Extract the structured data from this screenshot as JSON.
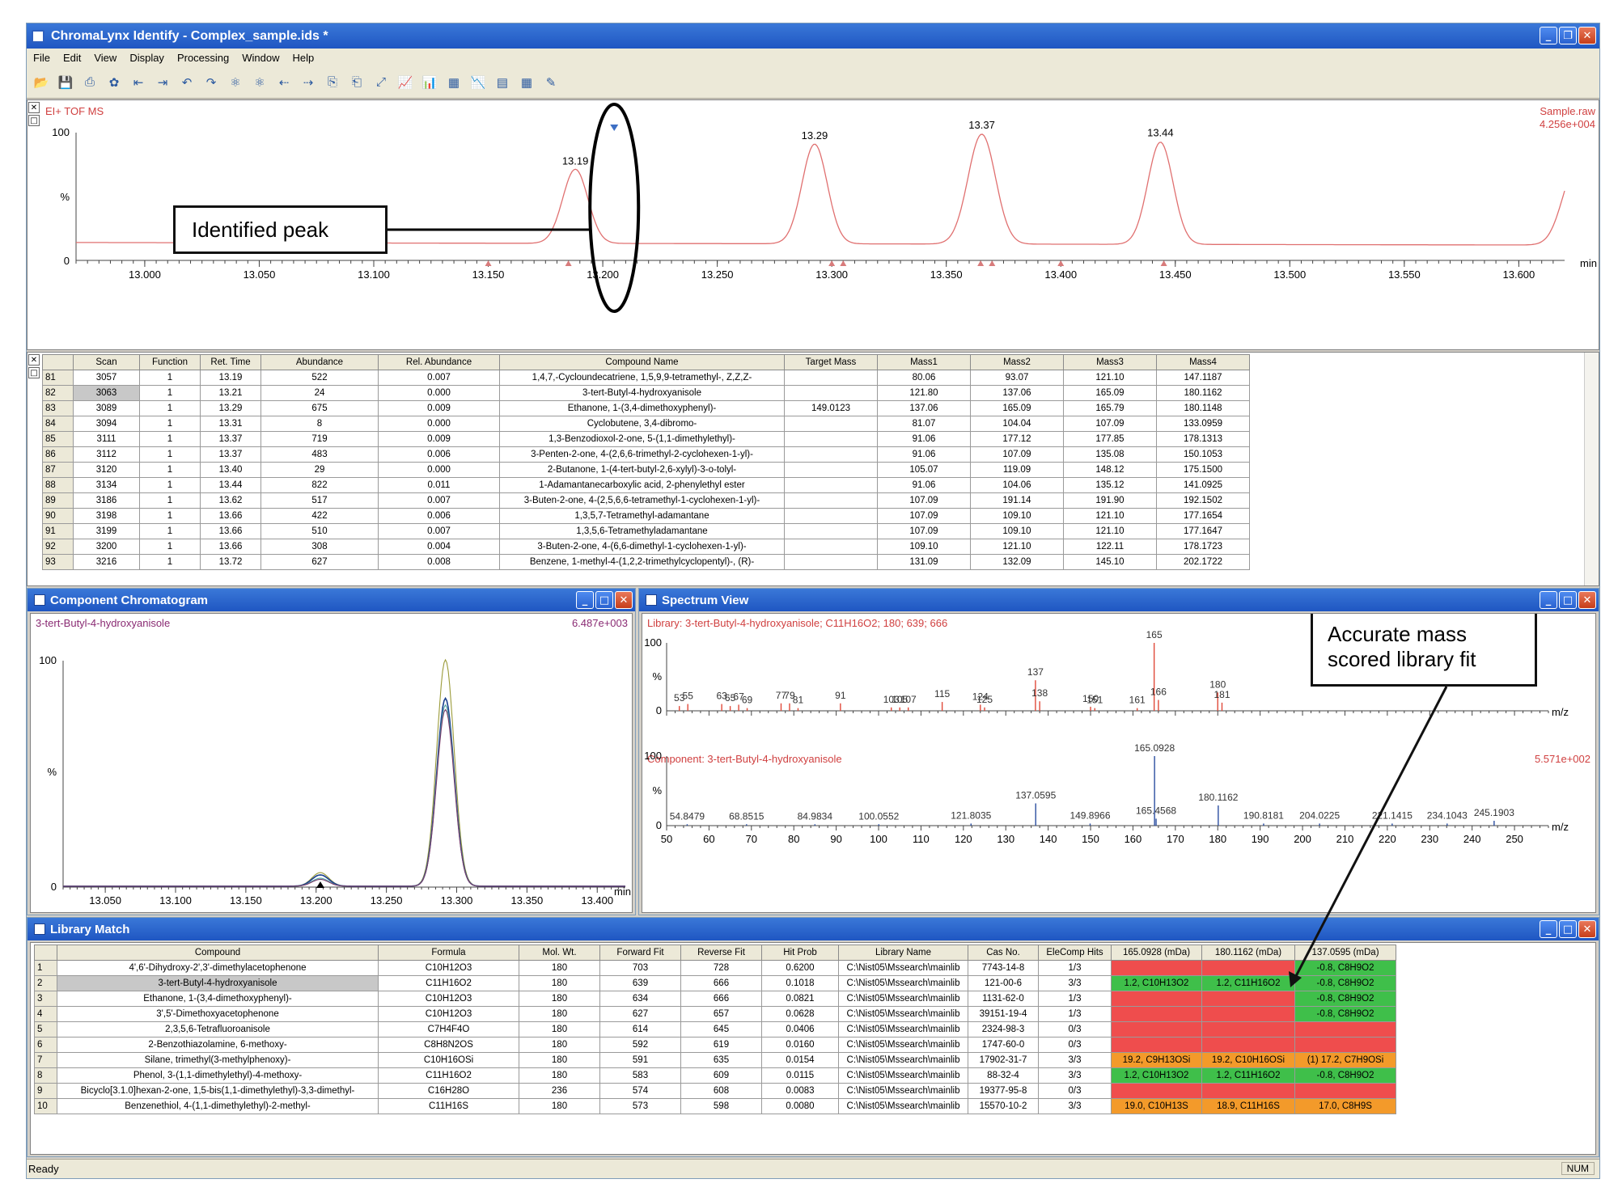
{
  "title": "ChromaLynx Identify - Complex_sample.ids *",
  "menu": [
    "File",
    "Edit",
    "View",
    "Display",
    "Processing",
    "Window",
    "Help"
  ],
  "status": "Ready",
  "num": "NUM",
  "tic": {
    "label": "EI+ TOF MS",
    "file": "Sample.raw",
    "intensity": "4.256e+004",
    "y100": "100",
    "ypct": "%",
    "y0": "0",
    "unit": "min",
    "ticks": [
      "13.000",
      "13.050",
      "13.100",
      "13.150",
      "13.200",
      "13.250",
      "13.300",
      "13.350",
      "13.400",
      "13.450",
      "13.500",
      "13.550",
      "13.600"
    ],
    "peaks": [
      "13.19",
      "13.29",
      "13.37",
      "13.44"
    ]
  },
  "callouts": {
    "identified": "Identified peak",
    "accurate1": "Accurate mass",
    "accurate2": "scored library fit"
  },
  "peak_table": {
    "headers": [
      "",
      "Scan",
      "Function",
      "Ret. Time",
      "Abundance",
      "Rel. Abundance",
      "Compound Name",
      "Target Mass",
      "Mass1",
      "Mass2",
      "Mass3",
      "Mass4"
    ],
    "rows": [
      [
        "81",
        "3057",
        "1",
        "13.19",
        "522",
        "0.007",
        "1,4,7,-Cycloundecatriene, 1,5,9,9-tetramethyl-, Z,Z,Z-",
        "",
        "80.06",
        "93.07",
        "121.10",
        "147.1187"
      ],
      [
        "82",
        "3063",
        "1",
        "13.21",
        "24",
        "0.000",
        "3-tert-Butyl-4-hydroxyanisole",
        "",
        "121.80",
        "137.06",
        "165.09",
        "180.1162"
      ],
      [
        "83",
        "3089",
        "1",
        "13.29",
        "675",
        "0.009",
        "Ethanone, 1-(3,4-dimethoxyphenyl)-",
        "149.0123",
        "137.06",
        "165.09",
        "165.79",
        "180.1148"
      ],
      [
        "84",
        "3094",
        "1",
        "13.31",
        "8",
        "0.000",
        "Cyclobutene, 3,4-dibromo-",
        "",
        "81.07",
        "104.04",
        "107.09",
        "133.0959"
      ],
      [
        "85",
        "3111",
        "1",
        "13.37",
        "719",
        "0.009",
        "1,3-Benzodioxol-2-one, 5-(1,1-dimethylethyl)-",
        "",
        "91.06",
        "177.12",
        "177.85",
        "178.1313"
      ],
      [
        "86",
        "3112",
        "1",
        "13.37",
        "483",
        "0.006",
        "3-Penten-2-one, 4-(2,6,6-trimethyl-2-cyclohexen-1-yl)-",
        "",
        "91.06",
        "107.09",
        "135.08",
        "150.1053"
      ],
      [
        "87",
        "3120",
        "1",
        "13.40",
        "29",
        "0.000",
        "2-Butanone, 1-(4-tert-butyl-2,6-xylyl)-3-o-tolyl-",
        "",
        "105.07",
        "119.09",
        "148.12",
        "175.1500"
      ],
      [
        "88",
        "3134",
        "1",
        "13.44",
        "822",
        "0.011",
        "1-Adamantanecarboxylic acid, 2-phenylethyl ester",
        "",
        "91.06",
        "104.06",
        "135.12",
        "141.0925"
      ],
      [
        "89",
        "3186",
        "1",
        "13.62",
        "517",
        "0.007",
        "3-Buten-2-one, 4-(2,5,6,6-tetramethyl-1-cyclohexen-1-yl)-",
        "",
        "107.09",
        "191.14",
        "191.90",
        "192.1502"
      ],
      [
        "90",
        "3198",
        "1",
        "13.66",
        "422",
        "0.006",
        "1,3,5,7-Tetramethyl-adamantane",
        "",
        "107.09",
        "109.10",
        "121.10",
        "177.1654"
      ],
      [
        "91",
        "3199",
        "1",
        "13.66",
        "510",
        "0.007",
        "1,3,5,6-Tetramethyladamantane",
        "",
        "107.09",
        "109.10",
        "121.10",
        "177.1647"
      ],
      [
        "92",
        "3200",
        "1",
        "13.66",
        "308",
        "0.004",
        "3-Buten-2-one, 4-(6,6-dimethyl-1-cyclohexen-1-yl)-",
        "",
        "109.10",
        "121.10",
        "122.11",
        "178.1723"
      ],
      [
        "93",
        "3216",
        "1",
        "13.72",
        "627",
        "0.008",
        "Benzene, 1-methyl-4-(1,2,2-trimethylcyclopentyl)-, (R)-",
        "",
        "131.09",
        "132.09",
        "145.10",
        "202.1722"
      ]
    ]
  },
  "component": {
    "title": "Component Chromatogram",
    "compound": "3-tert-Butyl-4-hydroxyanisole",
    "intensity": "6.487e+003",
    "y100": "100",
    "ypct": "%",
    "y0": "0",
    "unit": "min",
    "ticks": [
      "13.050",
      "13.100",
      "13.150",
      "13.200",
      "13.250",
      "13.300",
      "13.350",
      "13.400"
    ]
  },
  "spectrum": {
    "title": "Spectrum View",
    "library_label": "Library: 3-tert-Butyl-4-hydroxyanisole; C11H16O2; 180; 639; 666",
    "component_label": "Component: 3-tert-Butyl-4-hydroxyanisole",
    "component_intensity": "5.571e+002",
    "y100": "100",
    "ypct": "%",
    "y0": "0",
    "unit": "m/z",
    "lib_peaks": [
      [
        "53",
        7
      ],
      [
        "55",
        10
      ],
      [
        "63",
        10
      ],
      [
        "65",
        7
      ],
      [
        "67",
        9
      ],
      [
        "69",
        4
      ],
      [
        "77",
        11
      ],
      [
        "79",
        11
      ],
      [
        "81",
        4
      ],
      [
        "91",
        11
      ],
      [
        "103",
        5
      ],
      [
        "105",
        5
      ],
      [
        "107",
        5
      ],
      [
        "115",
        13
      ],
      [
        "124",
        9
      ],
      [
        "125",
        5
      ],
      [
        "137",
        45
      ],
      [
        "138",
        14
      ],
      [
        "150",
        6
      ],
      [
        "151",
        4
      ],
      [
        "161",
        4
      ],
      [
        "165",
        100
      ],
      [
        "166",
        16
      ],
      [
        "180",
        27
      ],
      [
        "181",
        12
      ]
    ],
    "cmp_peaks": [
      [
        "54.8479",
        2
      ],
      [
        "68.8515",
        2
      ],
      [
        "84.9834",
        2
      ],
      [
        "100.0552",
        2
      ],
      [
        "121.8035",
        3
      ],
      [
        "137.0595",
        32
      ],
      [
        "149.8966",
        3
      ],
      [
        "165.0928",
        100
      ],
      [
        "165.4568",
        10
      ],
      [
        "180.1162",
        29
      ],
      [
        "190.8181",
        3
      ],
      [
        "204.0225",
        3
      ],
      [
        "221.1415",
        3
      ],
      [
        "234.1043",
        3
      ],
      [
        "245.1903",
        7
      ]
    ],
    "ticks": [
      "50",
      "60",
      "70",
      "80",
      "90",
      "100",
      "110",
      "120",
      "130",
      "140",
      "150",
      "160",
      "170",
      "180",
      "190",
      "200",
      "210",
      "220",
      "230",
      "240",
      "250"
    ]
  },
  "library": {
    "title": "Library Match",
    "headers": [
      "",
      "Compound",
      "Formula",
      "Mol. Wt.",
      "Forward Fit",
      "Reverse Fit",
      "Hit Prob",
      "Library Name",
      "Cas No.",
      "EleComp Hits",
      "165.0928 (mDa)",
      "180.1162 (mDa)",
      "137.0595 (mDa)"
    ],
    "rows": [
      [
        "1",
        "4',6'-Dihydroxy-2',3'-dimethylacetophenone",
        "C10H12O3",
        "180",
        "703",
        "728",
        "0.6200",
        "C:\\Nist05\\Mssearch\\mainlib",
        "7743-14-8",
        "1/3",
        "",
        "",
        "-0.8, C8H9O2"
      ],
      [
        "2",
        "3-tert-Butyl-4-hydroxyanisole",
        "C11H16O2",
        "180",
        "639",
        "666",
        "0.1018",
        "C:\\Nist05\\Mssearch\\mainlib",
        "121-00-6",
        "3/3",
        "1.2, C10H13O2",
        "1.2, C11H16O2",
        "-0.8, C8H9O2"
      ],
      [
        "3",
        "Ethanone, 1-(3,4-dimethoxyphenyl)-",
        "C10H12O3",
        "180",
        "634",
        "666",
        "0.0821",
        "C:\\Nist05\\Mssearch\\mainlib",
        "1131-62-0",
        "1/3",
        "",
        "",
        "-0.8, C8H9O2"
      ],
      [
        "4",
        "3',5'-Dimethoxyacetophenone",
        "C10H12O3",
        "180",
        "627",
        "657",
        "0.0628",
        "C:\\Nist05\\Mssearch\\mainlib",
        "39151-19-4",
        "1/3",
        "",
        "",
        "-0.8, C8H9O2"
      ],
      [
        "5",
        "2,3,5,6-Tetrafluoroanisole",
        "C7H4F4O",
        "180",
        "614",
        "645",
        "0.0406",
        "C:\\Nist05\\Mssearch\\mainlib",
        "2324-98-3",
        "0/3",
        "",
        "",
        ""
      ],
      [
        "6",
        "2-Benzothiazolamine, 6-methoxy-",
        "C8H8N2OS",
        "180",
        "592",
        "619",
        "0.0160",
        "C:\\Nist05\\Mssearch\\mainlib",
        "1747-60-0",
        "0/3",
        "",
        "",
        ""
      ],
      [
        "7",
        "Silane, trimethyl(3-methylphenoxy)-",
        "C10H16OSi",
        "180",
        "591",
        "635",
        "0.0154",
        "C:\\Nist05\\Mssearch\\mainlib",
        "17902-31-7",
        "3/3",
        "19.2, C9H13OSi",
        "19.2, C10H16OSi",
        "(1) 17.2, C7H9OSi"
      ],
      [
        "8",
        "Phenol, 3-(1,1-dimethylethyl)-4-methoxy-",
        "C11H16O2",
        "180",
        "583",
        "609",
        "0.0115",
        "C:\\Nist05\\Mssearch\\mainlib",
        "88-32-4",
        "3/3",
        "1.2, C10H13O2",
        "1.2, C11H16O2",
        "-0.8, C8H9O2"
      ],
      [
        "9",
        "Bicyclo[3.1.0]hexan-2-one, 1,5-bis(1,1-dimethylethyl)-3,3-dimethyl-",
        "C16H28O",
        "236",
        "574",
        "608",
        "0.0083",
        "C:\\Nist05\\Mssearch\\mainlib",
        "19377-95-8",
        "0/3",
        "",
        "",
        ""
      ],
      [
        "10",
        "Benzenethiol, 4-(1,1-dimethylethyl)-2-methyl-",
        "C11H16S",
        "180",
        "573",
        "598",
        "0.0080",
        "C:\\Nist05\\Mssearch\\mainlib",
        "15570-10-2",
        "3/3",
        "19.0, C10H13S",
        "18.9, C11H16S",
        "17.0, C8H9S"
      ]
    ],
    "cellcolors": [
      [
        "r",
        "r",
        "g"
      ],
      [
        "g",
        "g",
        "g"
      ],
      [
        "r",
        "r",
        "g"
      ],
      [
        "r",
        "r",
        "g"
      ],
      [
        "r",
        "r",
        "r"
      ],
      [
        "r",
        "r",
        "r"
      ],
      [
        "o",
        "o",
        "o"
      ],
      [
        "g",
        "g",
        "g"
      ],
      [
        "r",
        "r",
        "r"
      ],
      [
        "o",
        "o",
        "o"
      ]
    ]
  }
}
